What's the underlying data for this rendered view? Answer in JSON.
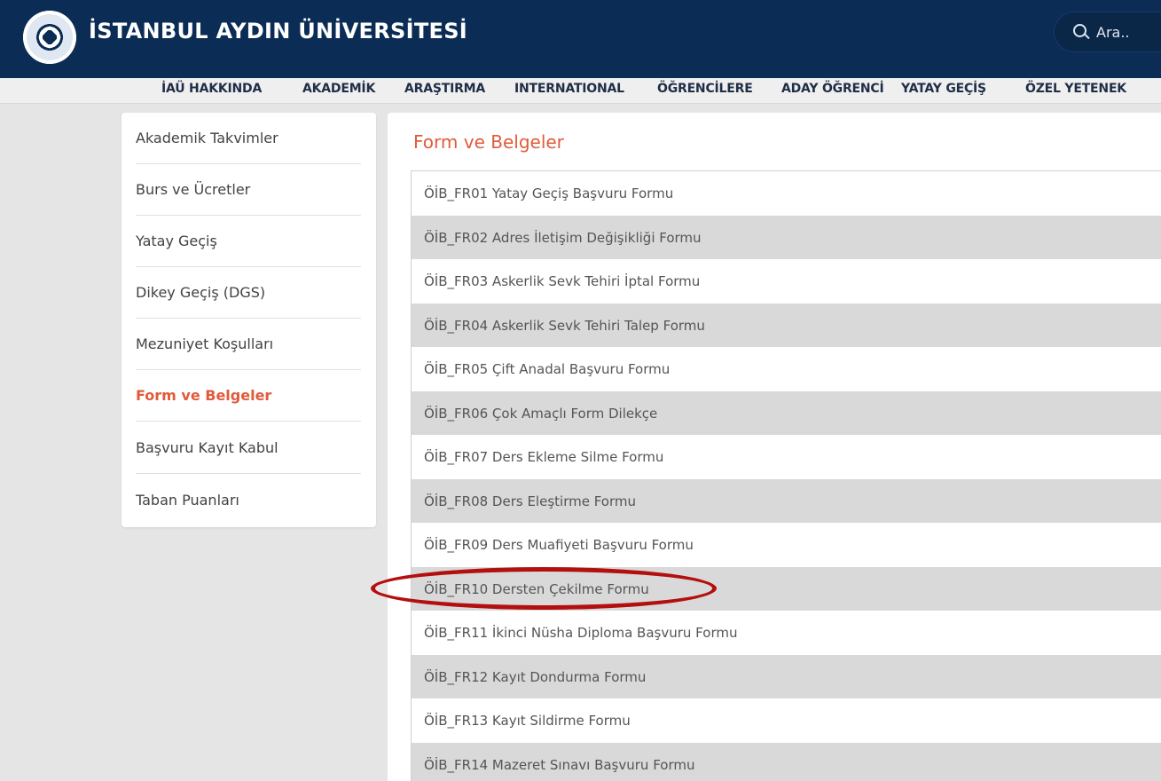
{
  "header": {
    "university_name": "İSTANBUL AYDIN ÜNİVERSİTESİ",
    "search_placeholder": "Ara..",
    "search_icon": "search-icon",
    "logo_icon": "university-logo"
  },
  "menu": {
    "items": [
      "İAÜ HAKKINDA",
      "AKADEMİK",
      "ARAŞTIRMA",
      "INTERNATIONAL",
      "ÖĞRENCİLERE",
      "ADAY ÖĞRENCİ",
      "YATAY GEÇİŞ",
      "ÖZEL YETENEK"
    ]
  },
  "sidebar": {
    "items": [
      {
        "label": "Akademik Takvimler"
      },
      {
        "label": "Burs ve Ücretler"
      },
      {
        "label": "Yatay Geçiş"
      },
      {
        "label": "Dikey Geçiş (DGS)"
      },
      {
        "label": "Mezuniyet Koşulları"
      },
      {
        "label": "Form ve Belgeler",
        "active": true
      },
      {
        "label": "Başvuru Kayıt Kabul"
      },
      {
        "label": "Taban Puanları"
      }
    ]
  },
  "main": {
    "title": "Form ve Belgeler",
    "forms": [
      "ÖİB_FR01 Yatay Geçiş Başvuru Formu",
      "ÖİB_FR02 Adres İletişim Değişikliği Formu",
      "ÖİB_FR03 Askerlik Sevk Tehiri İptal Formu",
      "ÖİB_FR04 Askerlik Sevk Tehiri Talep Formu",
      "ÖİB_FR05 Çift Anadal Başvuru Formu",
      "ÖİB_FR06 Çok Amaçlı Form Dilekçe",
      "ÖİB_FR07 Ders Ekleme Silme Formu",
      "ÖİB_FR08 Ders Eleştirme Formu",
      "ÖİB_FR09 Ders Muafiyeti Başvuru Formu",
      "ÖİB_FR10 Dersten Çekilme Formu",
      "ÖİB_FR11 İkinci Nüsha Diploma Başvuru Formu",
      "ÖİB_FR12 Kayıt Dondurma Formu",
      "ÖİB_FR13 Kayıt Sildirme Formu",
      "ÖİB_FR14 Mazeret Sınavı Başvuru Formu"
    ]
  },
  "colors": {
    "header_bg": "#0b2d55",
    "accent": "#e05b3a",
    "highlight": "#b30f0f",
    "row_alt": "#d9d9d9"
  }
}
